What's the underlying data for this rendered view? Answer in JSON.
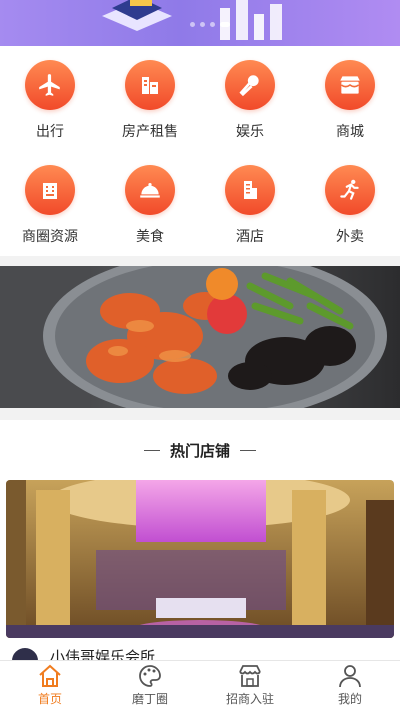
{
  "banner_dots": 4,
  "categories": [
    {
      "label": "出行",
      "icon": "airplane-icon"
    },
    {
      "label": "房产租售",
      "icon": "building-icon"
    },
    {
      "label": "娱乐",
      "icon": "microphone-icon"
    },
    {
      "label": "商城",
      "icon": "storefront-icon"
    },
    {
      "label": "商圈资源",
      "icon": "office-tower-icon"
    },
    {
      "label": "美食",
      "icon": "food-cloche-icon"
    },
    {
      "label": "酒店",
      "icon": "hotel-icon"
    },
    {
      "label": "外卖",
      "icon": "runner-icon"
    }
  ],
  "section": {
    "title": "热门店铺",
    "shop_name": "小伟哥娱乐会所"
  },
  "tabs": [
    {
      "label": "首页",
      "icon": "home-icon",
      "active": true
    },
    {
      "label": "磨丁圈",
      "icon": "palette-icon",
      "active": false
    },
    {
      "label": "招商入驻",
      "icon": "shop-icon",
      "active": false
    },
    {
      "label": "我的",
      "icon": "user-icon",
      "active": false
    }
  ],
  "colors": {
    "accent": "#f07c1f",
    "icon_gradient_top": "#ff8a52",
    "icon_gradient_bottom": "#f14a2a",
    "hero": "#9a82ee"
  }
}
